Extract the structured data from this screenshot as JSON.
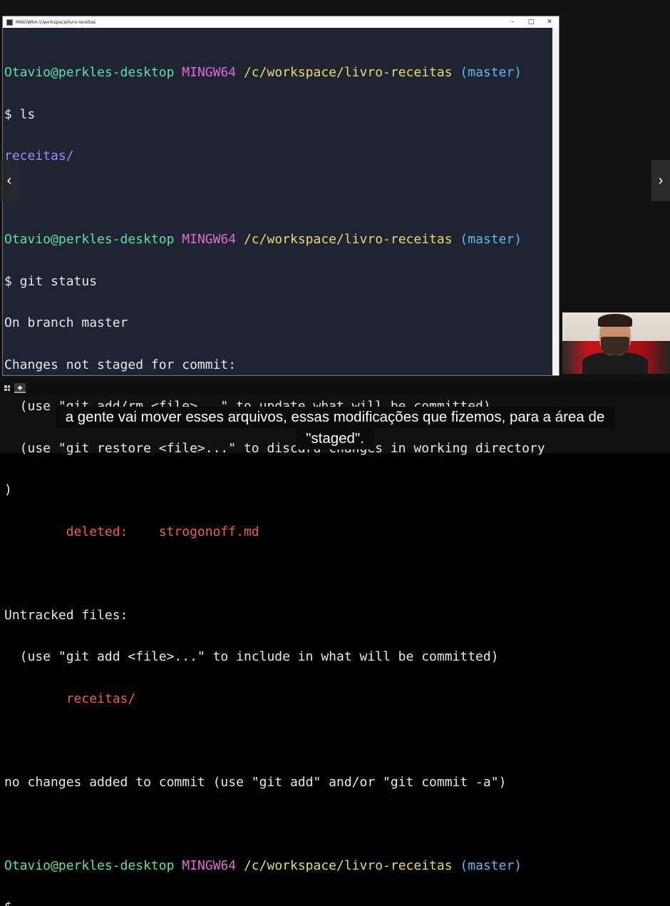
{
  "window": {
    "title": "MINGW64:/c/workspace/livro-receitas",
    "controls": [
      "–",
      "□",
      "✕"
    ]
  },
  "terminal": {
    "prompt_user": "Otavio@perkles-desktop",
    "prompt_ming": "MINGW64",
    "prompt_path": "/c/workspace/livro-receitas",
    "prompt_branch": "(master)",
    "cmd1": "$ ls",
    "out_ls": "receitas/",
    "cmd2": "$ git status",
    "l_branch": "On branch master",
    "l_notstaged": "Changes not staged for commit:",
    "l_hint1": "  (use \"git add/rm <file>...\" to update what will be committed)",
    "l_hint2": "  (use \"git restore <file>...\" to discard changes in working directory",
    "l_paren": ")",
    "l_deleted": "        deleted:    strogonoff.md",
    "l_untracked": "Untracked files:",
    "l_hint3": "  (use \"git add <file>...\" to include in what will be committed)",
    "l_untracked_dir": "        receitas/",
    "l_nochanges": "no changes added to commit (use \"git add\" and/or \"git commit -a\")",
    "cmd3": "$"
  },
  "nav": {
    "left": "‹",
    "right": "›"
  },
  "subtitle": {
    "line1": "a gente vai mover esses arquivos, essas modificações que fizemos, para a área de",
    "line2": "\"staged\"."
  },
  "colors": {
    "terminal_bg": "#1f2432",
    "user": "#5ee0a2",
    "mingw": "#e26bd4",
    "path": "#e9dc66",
    "branch": "#61b8f0",
    "directory": "#9d8df7",
    "deleted": "#f05a5a"
  },
  "icons": [
    "terminal-app-icon",
    "windows-start-icon",
    "chevron-left-icon",
    "chevron-right-icon"
  ]
}
